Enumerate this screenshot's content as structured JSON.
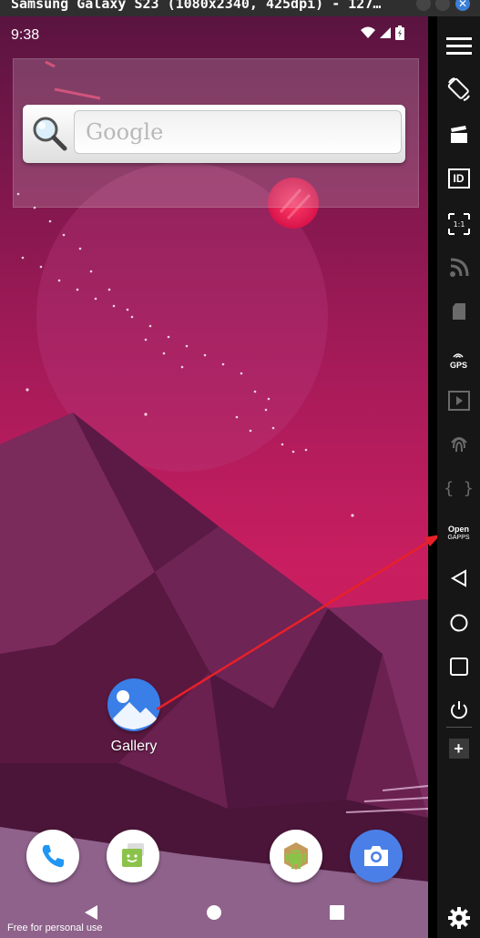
{
  "window": {
    "title": "Samsung Galaxy S23 (1080x2340, 425dpi) - 127…",
    "close_glyph": "✕"
  },
  "statusbar": {
    "time": "9:38",
    "icons": [
      "wifi-icon",
      "signal-icon",
      "battery-icon"
    ]
  },
  "search_widget": {
    "placeholder": "Google"
  },
  "desktop": {
    "apps": [
      {
        "label": "Gallery",
        "icon": "gallery-icon",
        "color": "#3a7ee8"
      }
    ]
  },
  "dock": [
    {
      "icon": "phone-icon",
      "color": "#ffffff"
    },
    {
      "icon": "messages-icon",
      "color": "#ffffff"
    },
    {
      "icon": "android-app-icon",
      "color": "#ffffff"
    },
    {
      "icon": "camera-icon",
      "color": "#4b7fe8"
    }
  ],
  "navbar": [
    "back-icon",
    "home-icon",
    "recents-icon"
  ],
  "watermark": "Free for personal use",
  "toolbar": {
    "items": [
      {
        "name": "menu-icon"
      },
      {
        "name": "rotate-icon"
      },
      {
        "name": "screen-record-icon"
      },
      {
        "name": "device-id",
        "text": "ID"
      },
      {
        "name": "pixel-perfect",
        "text": "1:1"
      },
      {
        "name": "rss-icon",
        "disabled": true
      },
      {
        "name": "sd-card-icon",
        "disabled": true
      },
      {
        "name": "gps",
        "text": "GPS"
      },
      {
        "name": "media-icon",
        "disabled": true
      },
      {
        "name": "fingerprint-icon",
        "disabled": true
      },
      {
        "name": "code-icon",
        "text": "{ }",
        "disabled": true
      },
      {
        "name": "open-gapps",
        "text": "Open",
        "subtext": "GAPPS"
      },
      {
        "name": "back-icon"
      },
      {
        "name": "home-icon"
      },
      {
        "name": "recents-icon"
      },
      {
        "name": "power-icon"
      },
      {
        "name": "add-icon",
        "text": "+"
      },
      {
        "name": "settings-icon"
      }
    ]
  },
  "colors": {
    "accent_red": "#e8202a",
    "wallpaper_pink": "#c01c5c",
    "wallpaper_purple": "#6a1e52"
  }
}
